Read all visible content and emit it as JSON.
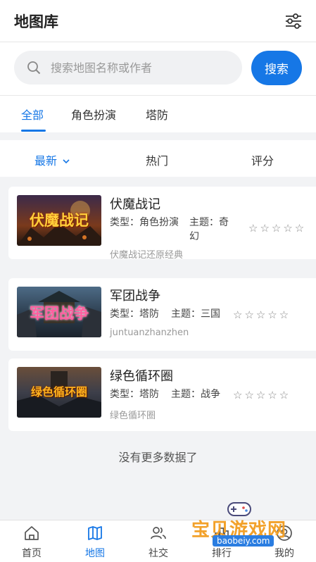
{
  "header": {
    "title": "地图库"
  },
  "search": {
    "placeholder": "搜索地图名称或作者",
    "value": "",
    "button": "搜索"
  },
  "category_tabs": [
    {
      "label": "全部",
      "active": true
    },
    {
      "label": "角色扮演",
      "active": false
    },
    {
      "label": "塔防",
      "active": false
    }
  ],
  "sort_options": [
    {
      "label": "最新",
      "active": true
    },
    {
      "label": "热门",
      "active": false
    },
    {
      "label": "评分",
      "active": false
    }
  ],
  "maps": [
    {
      "name": "伏魔战记",
      "cover_text": "伏魔战记",
      "type_label": "类型：角色扮演",
      "theme_label": "主题：奇幻",
      "description": "伏魔战记还原经典",
      "rating": "☆☆☆☆☆"
    },
    {
      "name": "军团战争",
      "cover_text": "军团战争",
      "type_label": "类型：塔防",
      "theme_label": "主题：三国",
      "description": "juntuanzhanzhen",
      "rating": "☆☆☆☆☆"
    },
    {
      "name": "绿色循环圈",
      "cover_text": "绿色循环圈",
      "type_label": "类型：塔防",
      "theme_label": "主题：战争",
      "description": "绿色循环圈",
      "rating": "☆☆☆☆☆"
    }
  ],
  "footer_note": "没有更多数据了",
  "bottom_nav": [
    {
      "label": "首页",
      "icon": "home-icon",
      "active": false
    },
    {
      "label": "地图",
      "icon": "map-icon",
      "active": true
    },
    {
      "label": "社交",
      "icon": "people-icon",
      "active": false
    },
    {
      "label": "排行",
      "icon": "ranking-icon",
      "active": false
    },
    {
      "label": "我的",
      "icon": "user-icon",
      "active": false
    }
  ],
  "watermark": {
    "text": "宝贝游戏网",
    "url": "baobeiy.com"
  },
  "colors": {
    "accent": "#1677e6",
    "background": "#f2f3f5",
    "watermark": "#f2a12a"
  }
}
